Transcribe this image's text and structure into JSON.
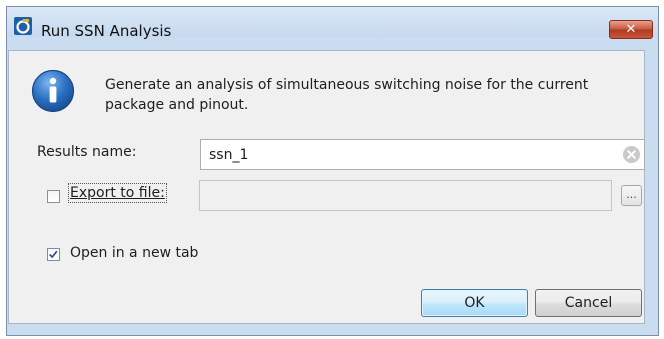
{
  "window": {
    "title": "Run SSN Analysis",
    "close_label": "✕"
  },
  "dialog": {
    "description": "Generate an analysis of simultaneous switching noise for the current package and pinout.",
    "results_name_label": "Results name:",
    "results_name_value": "ssn_1",
    "export_label": "Export to file:",
    "export_checked": false,
    "export_path_value": "",
    "browse_label": "...",
    "open_tab_label": "Open in a new tab",
    "open_tab_checked": true,
    "ok_label": "OK",
    "cancel_label": "Cancel"
  },
  "icons": {
    "app": "quartus-app-icon",
    "info": "info-icon",
    "clear": "clear-input-icon",
    "check": "checkmark-icon"
  },
  "colors": {
    "titlebar": "#c6d9ee",
    "close_button": "#c0392b",
    "default_button_border": "#3c7fb1"
  }
}
